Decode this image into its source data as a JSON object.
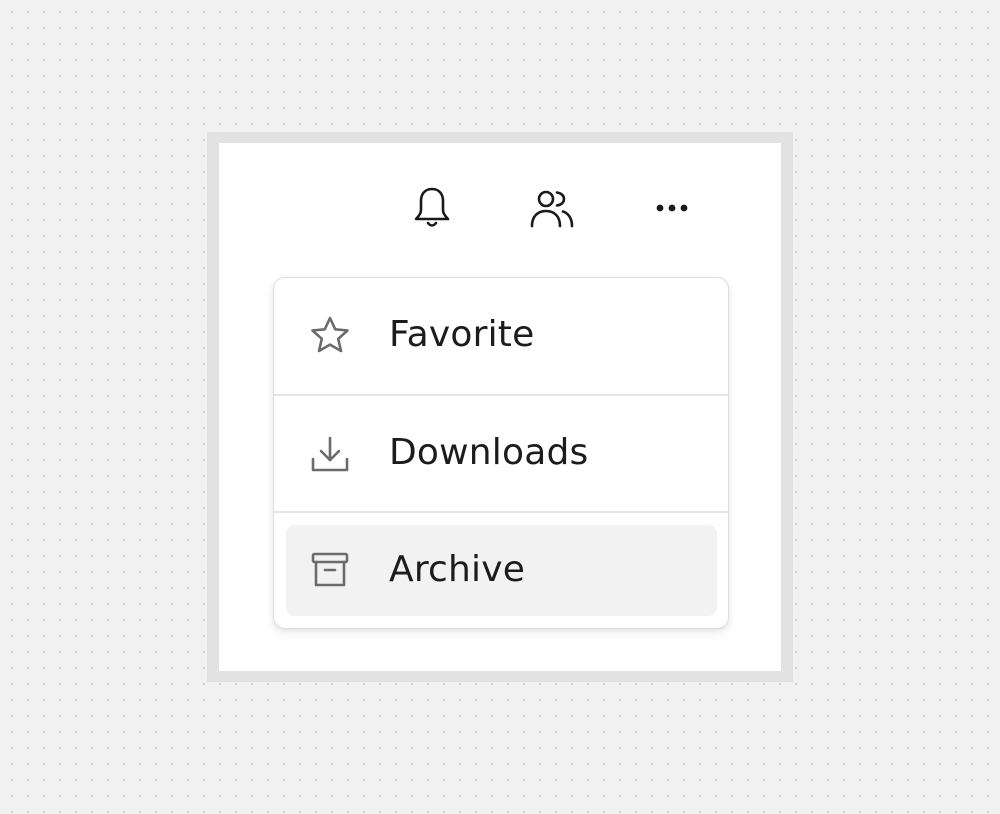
{
  "toolbar": {
    "icons": [
      "bell-icon",
      "people-icon",
      "more-horizontal-icon"
    ]
  },
  "menu": {
    "items": [
      {
        "label": "Favorite",
        "icon": "star-icon"
      },
      {
        "label": "Downloads",
        "icon": "download-icon"
      },
      {
        "label": "Archive",
        "icon": "archive-icon",
        "highlighted": true
      }
    ]
  },
  "colors": {
    "canvas_background": "#f1f1f1",
    "frame": "#e2e2e2",
    "panel": "#ffffff",
    "icon_toolbar": "#1a1a1a",
    "icon_menu": "#6b6b6b",
    "highlight": "#f2f2f2",
    "divider": "#e4e4e4"
  }
}
